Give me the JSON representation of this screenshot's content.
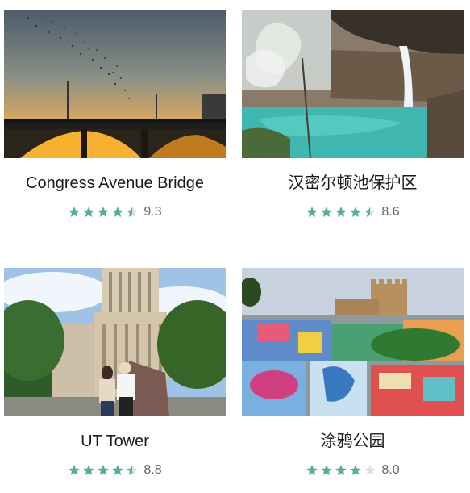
{
  "colors": {
    "star_on": "#57b087",
    "star_off": "#e0e0e0",
    "title": "#1a1a1a",
    "score": "#666666"
  },
  "attractions": [
    {
      "name": "Congress Avenue Bridge",
      "rating": 4.5,
      "score": "9.3",
      "image": "bat-bridge-sunset"
    },
    {
      "name": "汉密尔顿池保护区",
      "rating": 4.5,
      "score": "8.6",
      "image": "hamilton-pool-waterfall"
    },
    {
      "name": "UT Tower",
      "rating": 4.5,
      "score": "8.8",
      "image": "ut-tower-visitors"
    },
    {
      "name": "涂鸦公园",
      "rating": 4,
      "score": "8.0",
      "image": "graffiti-park-castle"
    }
  ]
}
